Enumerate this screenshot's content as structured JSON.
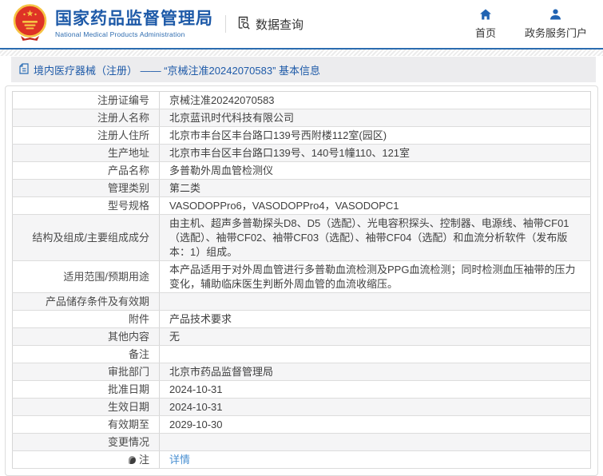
{
  "header": {
    "org_name_cn": "国家药品监督管理局",
    "org_name_en": "National Medical Products Administration",
    "nav_data_query": "数据查询",
    "nav_home": "首页",
    "nav_portal": "政务服务门户"
  },
  "breadcrumb": {
    "text": "境内医疗器械（注册） —— “京械注准20242070583” 基本信息"
  },
  "table": {
    "rows": [
      {
        "label": "注册证编号",
        "value": "京械注准20242070583"
      },
      {
        "label": "注册人名称",
        "value": "北京蓝讯时代科技有限公司"
      },
      {
        "label": "注册人住所",
        "value": "北京市丰台区丰台路口139号西附楼112室(园区)"
      },
      {
        "label": "生产地址",
        "value": "北京市丰台区丰台路口139号、140号1幢110、121室"
      },
      {
        "label": "产品名称",
        "value": "多普勒外周血管检测仪"
      },
      {
        "label": "管理类别",
        "value": "第二类"
      },
      {
        "label": "型号规格",
        "value": "VASODOPPro6，VASODOPPro4，VASODOPC1"
      },
      {
        "label": "结构及组成/主要组成成分",
        "value": "由主机、超声多普勒探头D8、D5（选配）、光电容积探头、控制器、电源线、袖带CF01（选配）、袖带CF02、袖带CF03（选配）、袖带CF04（选配）和血流分析软件（发布版本：1）组成。"
      },
      {
        "label": "适用范围/预期用途",
        "value": "本产品适用于对外周血管进行多普勒血流检测及PPG血流检测；同时检测血压袖带的压力变化，辅助临床医生判断外周血管的血流收缩压。"
      },
      {
        "label": "产品储存条件及有效期",
        "value": ""
      },
      {
        "label": "附件",
        "value": "产品技术要求"
      },
      {
        "label": "其他内容",
        "value": "无"
      },
      {
        "label": "备注",
        "value": ""
      },
      {
        "label": "审批部门",
        "value": "北京市药品监督管理局"
      },
      {
        "label": "批准日期",
        "value": "2024-10-31"
      },
      {
        "label": "生效日期",
        "value": "2024-10-31"
      },
      {
        "label": "有效期至",
        "value": "2029-10-30"
      },
      {
        "label": "变更情况",
        "value": ""
      },
      {
        "label": "注",
        "value": "详情",
        "link": true,
        "note_icon": true
      }
    ]
  },
  "colors": {
    "brand_blue": "#1e5aa8",
    "header_border_blue": "#2b6cb0",
    "link_blue": "#4a90d2",
    "row_alt": "#f5f5f6",
    "table_border": "#d6d6d6",
    "breadcrumb_bg": "#ececee",
    "emblem_red": "#de3226",
    "emblem_gold": "#f6c344"
  }
}
